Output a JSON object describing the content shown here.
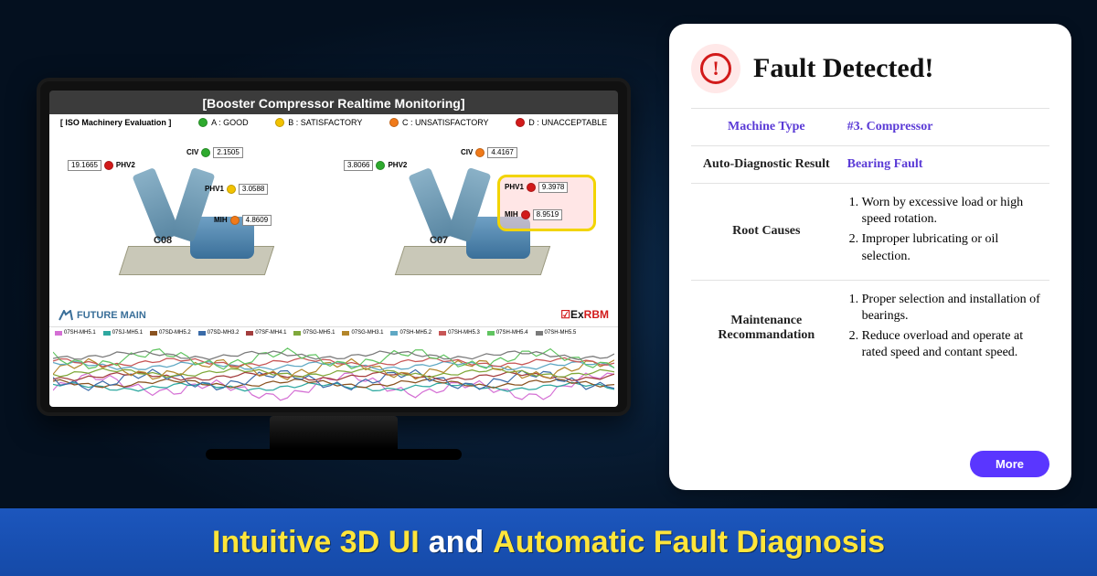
{
  "monitor": {
    "title": "[Booster Compressor Realtime Monitoring]",
    "evaluation": {
      "header": "[ ISO Machinery Evaluation ]",
      "a": "A : GOOD",
      "b": "B : SATISFACTORY",
      "c": "C : UNSATISFACTORY",
      "d": "D : UNACCEPTABLE"
    },
    "compressor_left": {
      "id": "C08",
      "phv2": {
        "name": "PHV2",
        "value": "19.1665"
      },
      "civ": {
        "name": "CIV",
        "value": "2.1505"
      },
      "phv1": {
        "name": "PHV1",
        "value": "3.0588"
      },
      "mih": {
        "name": "MIH",
        "value": "4.8609"
      }
    },
    "compressor_right": {
      "id": "C07",
      "phv2": {
        "name": "PHV2",
        "value": "3.8066"
      },
      "civ": {
        "name": "CIV",
        "value": "4.4167"
      },
      "phv1": {
        "name": "PHV1",
        "value": "9.3978"
      },
      "mih": {
        "name": "MIH",
        "value": "8.9519"
      }
    },
    "brand_left": "FUTURE MAIN",
    "brand_right_prefix": "Ex",
    "brand_right_suffix": "RBM"
  },
  "card": {
    "title": "Fault Detected!",
    "rows": {
      "machine_type": {
        "label": "Machine Type",
        "value": "#3. Compressor"
      },
      "auto_result": {
        "label": "Auto-Diagnostic Result",
        "value": "Bearing Fault"
      },
      "root_causes": {
        "label": "Root Causes",
        "items": [
          "Worn by excessive load or high speed rotation.",
          "Improper lubricating or oil selection."
        ]
      },
      "maintenance": {
        "label": "Maintenance Recommandation",
        "items": [
          "Proper selection and installation of bearings.",
          "Reduce overload and operate at rated speed and contant speed."
        ]
      }
    },
    "more": "More"
  },
  "banner": {
    "p1": "Intuitive 3D UI",
    "p2": "and",
    "p3": "Automatic Fault Diagnosis"
  },
  "chart_data": {
    "type": "line",
    "title": "",
    "xlabel": "",
    "ylabel": "",
    "ylim": [
      0,
      12
    ],
    "series": [
      {
        "name": "07SH-MH5.1",
        "color": "#d46fd4"
      },
      {
        "name": "07SJ-MH5.1",
        "color": "#2ea8a0"
      },
      {
        "name": "07SD-MH5.2",
        "color": "#8a5320"
      },
      {
        "name": "07SD-MH3.2",
        "color": "#3a6ba8"
      },
      {
        "name": "07SF-MH4.1",
        "color": "#a33d3d"
      },
      {
        "name": "07SG-MH5.1",
        "color": "#7fa83a"
      },
      {
        "name": "07SG-MH3.1",
        "color": "#b3862a"
      },
      {
        "name": "07SH-MH5.2",
        "color": "#5fa8c4"
      },
      {
        "name": "07SH-MH5.3",
        "color": "#c75656"
      },
      {
        "name": "07SH-MH5.4",
        "color": "#60c460"
      },
      {
        "name": "07SH-MH5.5",
        "color": "#7a7a7a"
      }
    ]
  }
}
